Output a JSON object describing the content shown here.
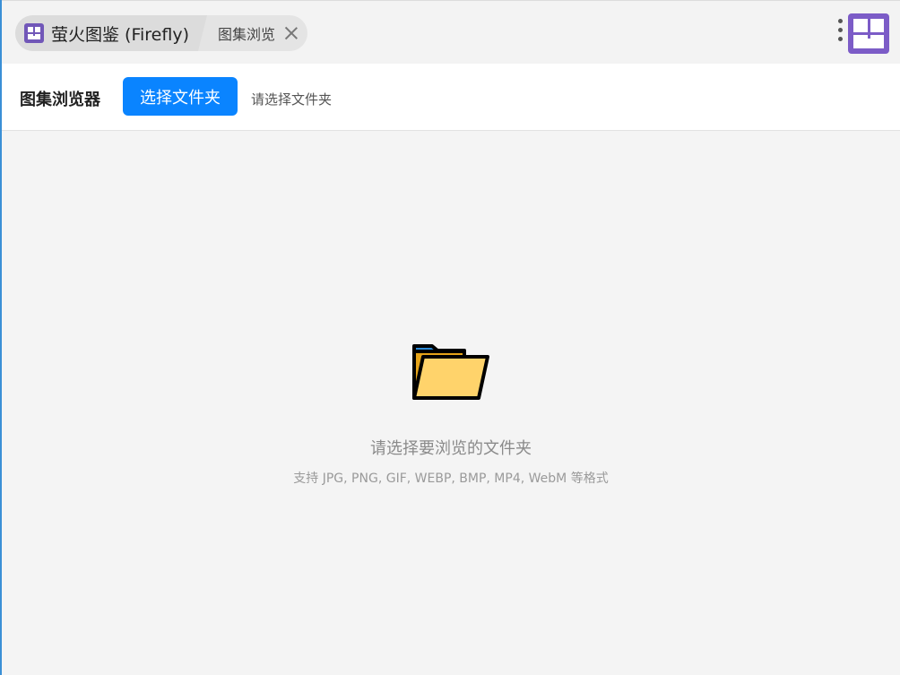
{
  "window": {
    "app_tab_label": "萤火图鉴 (Firefly)",
    "active_tab_label": "图集浏览",
    "icons": {
      "app": "app-logo-icon",
      "close": "close-icon",
      "more": "more-vertical-icon",
      "brand": "brand-logo-icon"
    }
  },
  "toolbar": {
    "title": "图集浏览器",
    "select_button_label": "选择文件夹",
    "hint": "请选择文件夹"
  },
  "empty_state": {
    "icon": "folder-icon",
    "title": "请选择要浏览的文件夹",
    "subtitle": "支持 JPG, PNG, GIF, WEBP, BMP, MP4, WebM 等格式"
  },
  "colors": {
    "accent": "#0a84ff",
    "brand": "#7c5cc7",
    "folder": "#ffd36b"
  }
}
